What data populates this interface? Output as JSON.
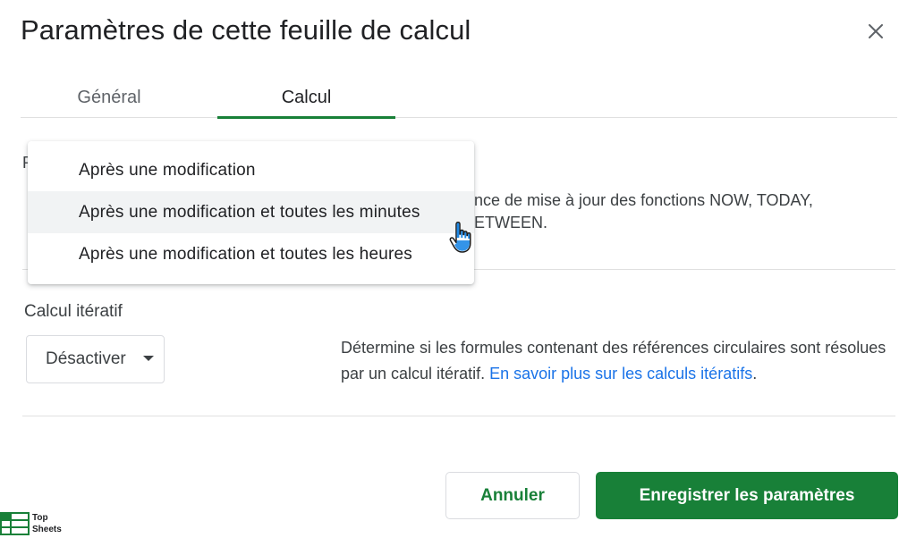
{
  "dialog": {
    "title": "Paramètres de cette feuille de calcul"
  },
  "tabs": [
    {
      "label": "Général",
      "active": false
    },
    {
      "label": "Calcul",
      "active": true
    }
  ],
  "recalc": {
    "label_partial": "R",
    "description_line1": "nce de mise à jour des fonctions NOW, TODAY,",
    "description_line2": "ETWEEN.",
    "menu_options": [
      "Après une modification",
      "Après une modification et toutes les minutes",
      "Après une modification et toutes les heures"
    ]
  },
  "iterative": {
    "label": "Calcul itératif",
    "selected": "Désactiver",
    "description": "Détermine si les formules contenant des références circulaires sont résolues par un calcul itératif.",
    "link": "En savoir plus sur les calculs itératifs",
    "link_suffix": "."
  },
  "footer": {
    "cancel_label": "Annuler",
    "save_label": "Enregistrer les paramètres"
  },
  "watermark": {
    "line1": "Top",
    "line2": "Sheets"
  },
  "colors": {
    "accent_green": "#188038",
    "link_blue": "#1a73e8",
    "hover_bg": "#f1f3f4"
  },
  "icons": {
    "close": "close-icon",
    "caret": "caret-down-icon",
    "cursor": "hand-pointer-icon",
    "logo": "sheets-logo-icon"
  }
}
